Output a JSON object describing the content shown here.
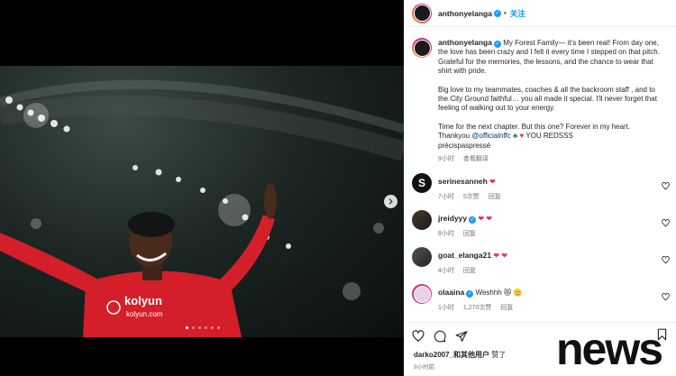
{
  "post": {
    "username": "anthonyelanga",
    "separator": "•",
    "follow_label": "关注",
    "caption": {
      "p1": "My Forest Family— it's been real! From day one, the love has been crazy and I felt it every time I stepped on that pitch. Grateful for the memories, the lessons, and the chance to wear that shirt with pride.",
      "p2": "Big love to my teammates, coaches & all the backroom staff , and to the City Ground faithful… you all made it special. I'll never forget that feeling of walking out to your energy.",
      "p3_a": "Time for the next chapter. But this one? Forever in my heart. Thankyou",
      "p3_mention": "@officialnffc",
      "p3_b": "YOU REDSSS",
      "p4": "précispaspressé",
      "time": "9小时",
      "translate_label": "查看翻译"
    },
    "likes_text": "darko2007_和其他用户",
    "likes_suffix": "赞了",
    "posted_time": "9小时前"
  },
  "comments": [
    {
      "user": "serinesanneh",
      "text": "",
      "hearts": "❤",
      "time": "7小时",
      "likes": "5次赞",
      "reply": "回复",
      "verified": false
    },
    {
      "user": "jreidyyy",
      "text": "",
      "hearts": "❤ ❤",
      "time": "8小时",
      "likes": "",
      "reply": "回复",
      "verified": true
    },
    {
      "user": "goat_elanga21",
      "text": "",
      "hearts": "❤ ❤",
      "time": "4小时",
      "likes": "",
      "reply": "回复",
      "verified": false
    },
    {
      "user": "olaaina",
      "text": "Weshhh",
      "hearts": "😻 🫡",
      "time": "1小时",
      "likes": "1,270次赞",
      "reply": "回复",
      "verified": true
    }
  ],
  "watermark": "news",
  "colors": {
    "accent": "#0095f6",
    "verified": "#1d9bf0",
    "heart": "#e1306c",
    "jersey": "#d41f2b"
  },
  "icons": [
    "heart-icon",
    "comment-icon",
    "share-icon",
    "bookmark-icon",
    "chevron-right-icon"
  ]
}
